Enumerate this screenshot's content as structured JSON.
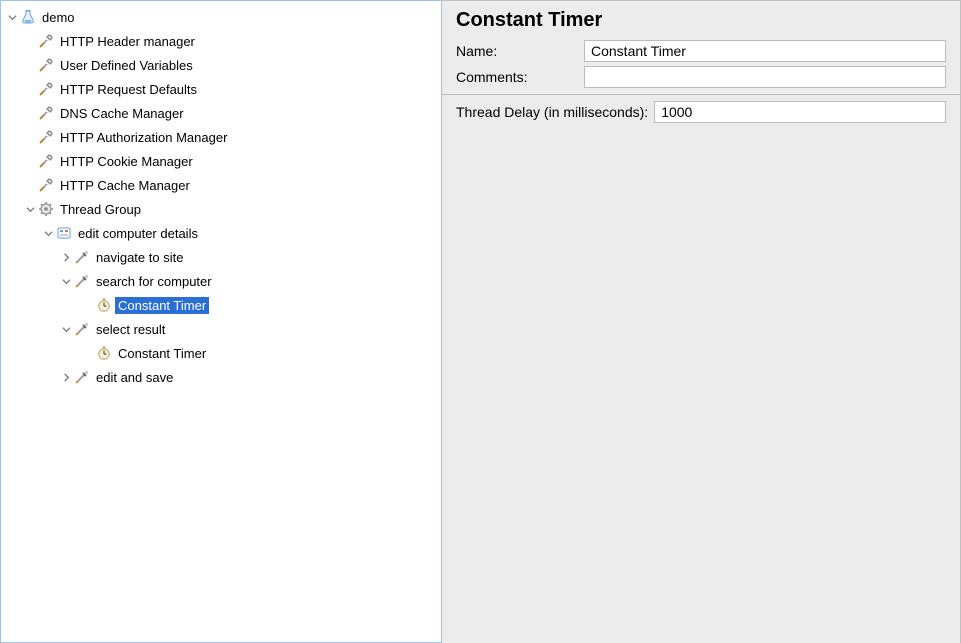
{
  "tree": {
    "root": "demo",
    "items": {
      "httpHeader": "HTTP Header manager",
      "userVars": "User Defined Variables",
      "httpReqDef": "HTTP Request Defaults",
      "dnsCache": "DNS Cache Manager",
      "httpAuth": "HTTP Authorization Manager",
      "httpCookie": "HTTP Cookie Manager",
      "httpCache": "HTTP Cache Manager",
      "threadGroup": "Thread Group",
      "editComp": "edit computer details",
      "navSite": "navigate to site",
      "searchComp": "search for computer",
      "constTimer1": "Constant Timer",
      "selectResult": "select result",
      "constTimer2": "Constant Timer",
      "editSave": "edit and save"
    }
  },
  "details": {
    "title": "Constant Timer",
    "nameLabel": "Name:",
    "nameValue": "Constant Timer",
    "commentsLabel": "Comments:",
    "commentsValue": "",
    "delayLabel": "Thread Delay (in milliseconds):",
    "delayValue": "1000"
  }
}
